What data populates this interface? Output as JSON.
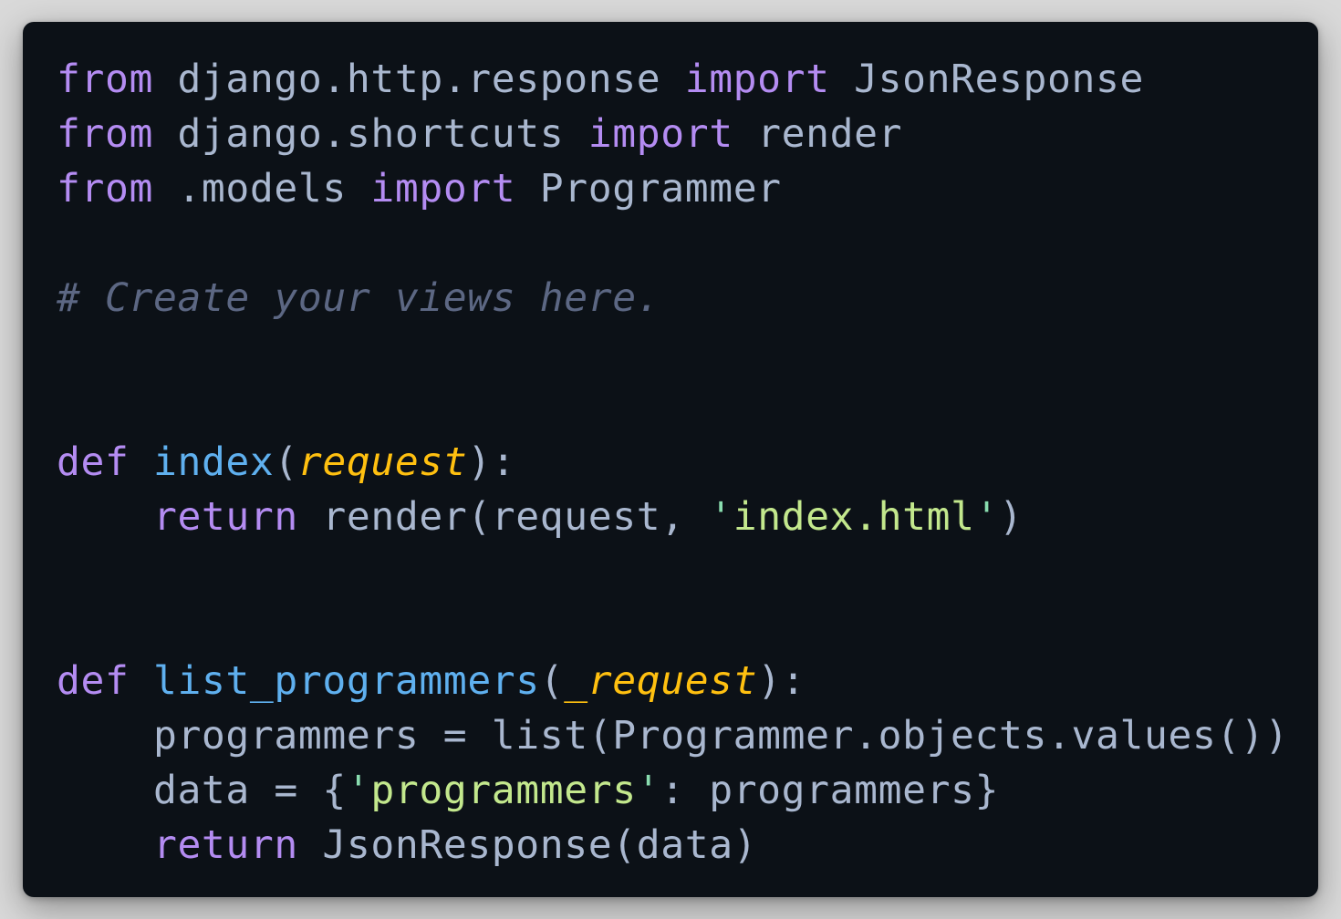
{
  "editor": {
    "language": "python",
    "lines": [
      [
        {
          "t": "from",
          "k": "kw"
        },
        {
          "t": " django.http.response ",
          "k": "plain"
        },
        {
          "t": "import",
          "k": "kw"
        },
        {
          "t": " JsonResponse",
          "k": "plain"
        }
      ],
      [
        {
          "t": "from",
          "k": "kw"
        },
        {
          "t": " django.shortcuts ",
          "k": "plain"
        },
        {
          "t": "import",
          "k": "kw"
        },
        {
          "t": " render",
          "k": "plain"
        }
      ],
      [
        {
          "t": "from",
          "k": "kw"
        },
        {
          "t": " .models ",
          "k": "plain"
        },
        {
          "t": "import",
          "k": "kw"
        },
        {
          "t": " Programmer",
          "k": "plain"
        }
      ],
      [],
      [
        {
          "t": "# Create your views here.",
          "k": "comment"
        }
      ],
      [],
      [],
      [
        {
          "t": "def",
          "k": "kw"
        },
        {
          "t": " ",
          "k": "plain"
        },
        {
          "t": "index",
          "k": "fn"
        },
        {
          "t": "(",
          "k": "plain"
        },
        {
          "t": "request",
          "k": "param"
        },
        {
          "t": "):",
          "k": "plain"
        }
      ],
      [
        {
          "t": "    ",
          "k": "plain"
        },
        {
          "t": "return",
          "k": "kw"
        },
        {
          "t": " render(request, ",
          "k": "plain"
        },
        {
          "t": "'",
          "k": "quote"
        },
        {
          "t": "index.html",
          "k": "str"
        },
        {
          "t": "'",
          "k": "quote"
        },
        {
          "t": ")",
          "k": "plain"
        }
      ],
      [],
      [],
      [
        {
          "t": "def",
          "k": "kw"
        },
        {
          "t": " ",
          "k": "plain"
        },
        {
          "t": "list_programmers",
          "k": "fn"
        },
        {
          "t": "(",
          "k": "plain"
        },
        {
          "t": "_request",
          "k": "param"
        },
        {
          "t": "):",
          "k": "plain"
        }
      ],
      [
        {
          "t": "    programmers = list(Programmer.objects.values())",
          "k": "plain"
        }
      ],
      [
        {
          "t": "    data = {",
          "k": "plain"
        },
        {
          "t": "'",
          "k": "quote"
        },
        {
          "t": "programmers",
          "k": "str"
        },
        {
          "t": "'",
          "k": "quote"
        },
        {
          "t": ": programmers}",
          "k": "plain"
        }
      ],
      [
        {
          "t": "    ",
          "k": "plain"
        },
        {
          "t": "return",
          "k": "kw"
        },
        {
          "t": " JsonResponse(data)",
          "k": "plain"
        }
      ]
    ]
  }
}
